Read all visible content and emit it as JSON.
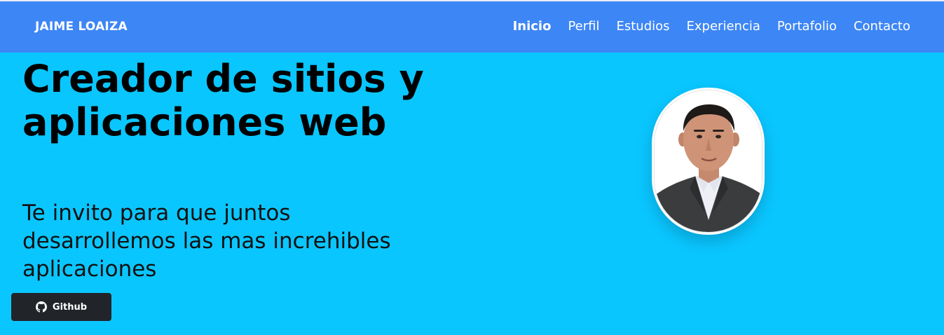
{
  "navbar": {
    "brand": "JAIME LOAIZA",
    "links": [
      {
        "label": "Inicio",
        "active": true
      },
      {
        "label": "Perfil",
        "active": false
      },
      {
        "label": "Estudios",
        "active": false
      },
      {
        "label": "Experiencia",
        "active": false
      },
      {
        "label": "Portafolio",
        "active": false
      },
      {
        "label": "Contacto",
        "active": false
      }
    ]
  },
  "hero": {
    "title": "Creador de sitios y aplicaciones web",
    "subtitle": "Te invito para que juntos desarrollemos las mas increhibles aplicaciones",
    "github_button": {
      "label": "Github",
      "icon": "github-icon"
    }
  },
  "colors": {
    "navbar": "#3d86f6",
    "background": "#0ac6ff",
    "button": "#212529"
  }
}
